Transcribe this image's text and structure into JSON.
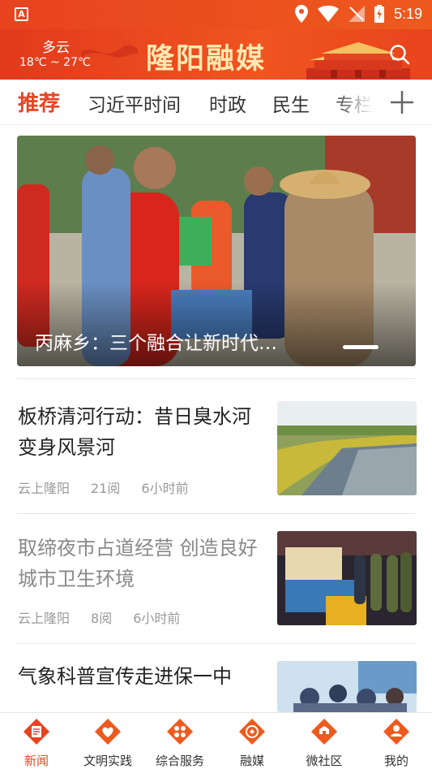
{
  "status_bar": {
    "time": "5:19",
    "app_icon": "A"
  },
  "header": {
    "weather_condition": "多云",
    "weather_temp": "18℃ ~ 27℃",
    "brand": "隆阳融媒",
    "accent": "#e8431f"
  },
  "tabs": [
    {
      "label": "推荐",
      "active": true
    },
    {
      "label": "习近平时间"
    },
    {
      "label": "时政"
    },
    {
      "label": "民生"
    },
    {
      "label": "专栏"
    }
  ],
  "hero": {
    "caption": "丙麻乡：三个融合让新时代…"
  },
  "articles": [
    {
      "title": "板桥清河行动：昔日臭水河变身风景河",
      "source": "云上隆阳",
      "reads": "21阅",
      "time": "6小时前",
      "read": false
    },
    {
      "title": "取缔夜市占道经营 创造良好城市卫生环境",
      "source": "云上隆阳",
      "reads": "8阅",
      "time": "6小时前",
      "read": true
    },
    {
      "title": "气象科普宣传走进保一中"
    }
  ],
  "bottom_nav": [
    {
      "label": "新闻",
      "icon": "news-icon",
      "active": true
    },
    {
      "label": "文明实践",
      "icon": "heart-hands-icon"
    },
    {
      "label": "综合服务",
      "icon": "services-icon"
    },
    {
      "label": "融媒",
      "icon": "media-icon"
    },
    {
      "label": "微社区",
      "icon": "community-icon"
    },
    {
      "label": "我的",
      "icon": "profile-icon"
    }
  ]
}
